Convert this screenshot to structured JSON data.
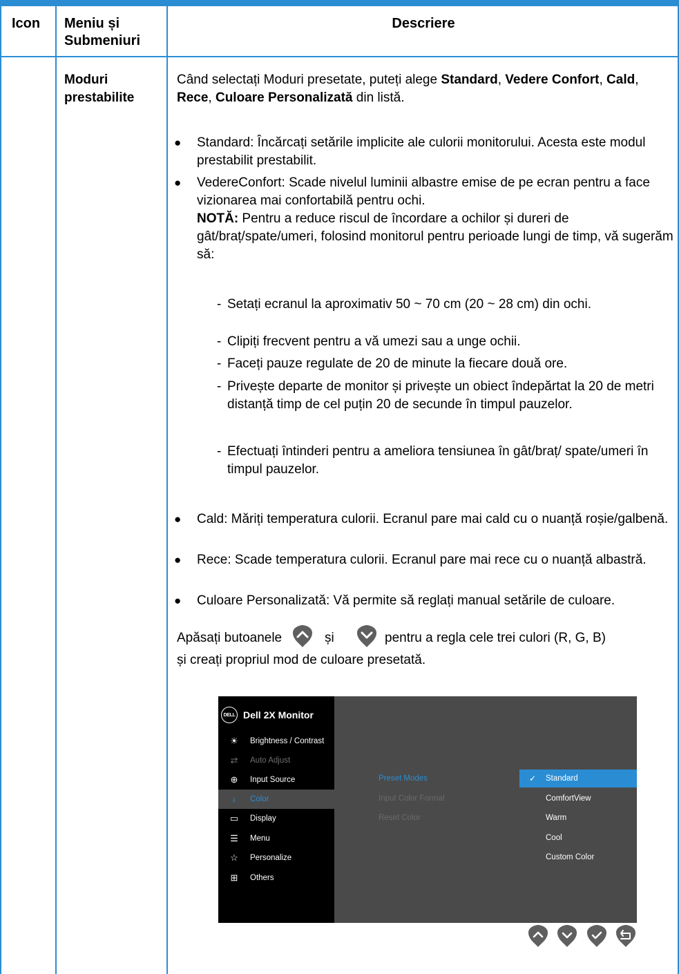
{
  "table": {
    "headers": {
      "icon": "Icon",
      "menu": "Meniu și Submeniuri",
      "description": "Descriere"
    },
    "row": {
      "menu_name": "Moduri prestabilite",
      "intro": {
        "p1": "Când selectați Moduri presetate, puteți alege ",
        "standard": "Standard",
        "sep1": ", ",
        "vedere": "Vedere Confort",
        "sep2": ", ",
        "cald": "Cald",
        "sep3": ", ",
        "rece": "Rece",
        "sep4": ", ",
        "culoare": "Culoare Personalizată",
        "p2": " din listă."
      },
      "bullets": {
        "standard": "Standard: Încărcați setările implicite ale culorii monitorului. Acesta este modul prestabilit prestabilit.",
        "comfort": "VedereConfort: Scade nivelul luminii albastre emise de pe ecran pentru a face vizionarea mai confortabilă pentru ochi.",
        "note_label": "NOTĂ:",
        "note_text": " Pentru a reduce riscul de încordare a ochilor și dureri de gât/braț/spate/umeri, folosind monitorul pentru perioade lungi de timp, vă sugerăm să:",
        "cald": "Cald: Măriți temperatura culorii. Ecranul pare mai cald cu o nuanță roșie/galbenă.",
        "rece": "Rece: Scade temperatura culorii. Ecranul pare mai rece cu o nuanță albastră.",
        "custom": "Culoare Personalizată: Vă permite să reglați manual setările de culoare."
      },
      "tips": [
        "Setați ecranul la aproximativ 50 ~ 70 cm (20 ~ 28 cm) din ochi.",
        "Clipiți frecvent pentru a vă umezi sau a unge ochii.",
        "Faceți pauze regulate de 20 de minute la fiecare două ore.",
        "Privește departe de monitor și privește un obiect îndepărtat la 20 de metri distanță timp de cel puțin 20 de secunde în timpul pauzelor.",
        "Efectuați întinderi pentru a ameliora tensiunea în gât/braț/ spate/umeri în timpul pauzelor."
      ],
      "press": {
        "a": "Apăsați butoanele",
        "b": "și",
        "c": "pentru a regla cele trei culori (R, G, B)",
        "d": "și creați propriul mod de culoare presetată."
      }
    }
  },
  "osd": {
    "logo": "DELL",
    "title": "Dell 2X Monitor",
    "menu": [
      {
        "label": "Brightness / Contrast",
        "icon": "brightness-icon"
      },
      {
        "label": "Auto Adjust",
        "icon": "auto-adjust-icon"
      },
      {
        "label": "Input Source",
        "icon": "input-source-icon"
      },
      {
        "label": "Color",
        "icon": "color-icon"
      },
      {
        "label": "Display",
        "icon": "display-icon"
      },
      {
        "label": "Menu",
        "icon": "menu-icon"
      },
      {
        "label": "Personalize",
        "icon": "star-icon"
      },
      {
        "label": "Others",
        "icon": "others-icon"
      }
    ],
    "submenu": [
      "Preset Modes",
      "Input Color Format",
      "Reset Color"
    ],
    "options": [
      "Standard",
      "ComfortView",
      "Warm",
      "Cool",
      "Custom Color"
    ],
    "selected_option": "Standard",
    "checkmark": "✓"
  },
  "colors": {
    "accent": "#2a8dd4",
    "button": "#5f5f5f",
    "osd_bg": "#4a4a4a"
  }
}
